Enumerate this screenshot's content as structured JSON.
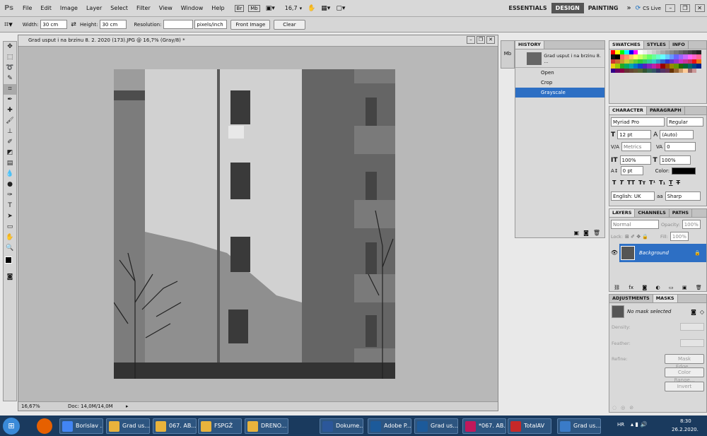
{
  "menubar": {
    "logo": "Ps",
    "items": [
      "File",
      "Edit",
      "Image",
      "Layer",
      "Select",
      "Filter",
      "View",
      "Window",
      "Help"
    ],
    "zoom": "16,7",
    "workspaces": [
      "ESSENTIALS",
      "DESIGN",
      "PAINTING"
    ],
    "cslive": "CS Live"
  },
  "options": {
    "width_label": "Width:",
    "width_value": "30 cm",
    "height_label": "Height:",
    "height_value": "30 cm",
    "resolution_label": "Resolution:",
    "resolution_value": "",
    "resolution_unit": "pixels/inch",
    "front_image": "Front Image",
    "clear": "Clear"
  },
  "document": {
    "title": "Grad usput i na brzinu 8. 2. 2020 (173).JPG @ 16,7% (Gray/8) *",
    "status_zoom": "16,67%",
    "status_doc": "Doc: 14,0M/14,0M"
  },
  "history": {
    "tab": "HISTORY",
    "snapshot": "Grad usput i na brzinu 8. ...",
    "steps": [
      "Open",
      "Crop",
      "Grayscale"
    ],
    "selected": 2
  },
  "swatches": {
    "tabs": [
      "SWATCHES",
      "STYLES",
      "INFO"
    ],
    "colors": [
      "#ff0000",
      "#ffff00",
      "#00ff00",
      "#00ffff",
      "#0000ff",
      "#ff00ff",
      "#ffffff",
      "#eeeeee",
      "#dddddd",
      "#cccccc",
      "#bbbbbb",
      "#aaaaaa",
      "#999999",
      "#888888",
      "#777777",
      "#666666",
      "#555555",
      "#444444",
      "#333333",
      "#222222",
      "#111111",
      "#000000",
      "#ff6666",
      "#ff9966",
      "#ffcc66",
      "#ffff66",
      "#ccff66",
      "#99ff66",
      "#66ff66",
      "#66ff99",
      "#66ffcc",
      "#66ffff",
      "#66ccff",
      "#6699ff",
      "#6666ff",
      "#9966ff",
      "#cc66ff",
      "#ff66ff",
      "#ff66cc",
      "#ff6699",
      "#cc3333",
      "#cc6633",
      "#cc9933",
      "#cccc33",
      "#99cc33",
      "#66cc33",
      "#33cc33",
      "#33cc66",
      "#33cc99",
      "#33cccc",
      "#3399cc",
      "#3366cc",
      "#3333cc",
      "#6633cc",
      "#9933cc",
      "#cc33cc",
      "#cc3399",
      "#cc3366",
      "#ee1111",
      "#ee7711",
      "#eecc11",
      "#99cc00",
      "#22aa22",
      "#00aa66",
      "#00aaaa",
      "#0077cc",
      "#1144cc",
      "#5522bb",
      "#8822bb",
      "#bb22aa",
      "#cc1177",
      "#990000",
      "#994400",
      "#998800",
      "#669900",
      "#226600",
      "#006633",
      "#006666",
      "#004488",
      "#002288",
      "#330088",
      "#660066",
      "#880044",
      "#663333",
      "#664433",
      "#665533",
      "#556633",
      "#335533",
      "#336655",
      "#335566",
      "#333366",
      "#553366",
      "#663355",
      "#663300",
      "#996633",
      "#cc9966",
      "#ffcc99",
      "#996666",
      "#cc9999"
    ]
  },
  "character": {
    "tabs": [
      "CHARACTER",
      "PARAGRAPH"
    ],
    "font": "Myriad Pro",
    "style": "Regular",
    "size": "12 pt",
    "leading": "(Auto)",
    "kerning": "Metrics",
    "tracking": "0",
    "vscale": "100%",
    "hscale": "100%",
    "baseline": "0 pt",
    "color_label": "Color:",
    "language": "English: UK",
    "aa": "Sharp"
  },
  "layers": {
    "tabs": [
      "LAYERS",
      "CHANNELS",
      "PATHS"
    ],
    "blend": "Normal",
    "opacity_label": "Opacity:",
    "opacity": "100%",
    "lock_label": "Lock:",
    "fill_label": "Fill:",
    "fill": "100%",
    "layer_name": "Background"
  },
  "masks": {
    "tabs": [
      "ADJUSTMENTS",
      "MASKS"
    ],
    "status": "No mask selected",
    "density": "Density:",
    "feather": "Feather:",
    "refine": "Refine:",
    "mask_edge": "Mask Edge...",
    "color_range": "Color Range...",
    "invert": "Invert"
  },
  "taskbar": {
    "items": [
      {
        "label": "Borislav ...",
        "icon": "chrome-icon",
        "color": "#4285f4"
      },
      {
        "label": "Grad us...",
        "icon": "folder-icon",
        "color": "#e8b33c"
      },
      {
        "label": "067. AB...",
        "icon": "folder-icon",
        "color": "#e8b33c"
      },
      {
        "label": "FSPGŽ",
        "icon": "folder-icon",
        "color": "#e8b33c"
      },
      {
        "label": "DRENO...",
        "icon": "folder-icon",
        "color": "#e8b33c"
      },
      {
        "label": "Dokume...",
        "icon": "word-icon",
        "color": "#2b579a"
      },
      {
        "label": "Adobe P...",
        "icon": "photoshop-icon",
        "color": "#1c5a9a"
      },
      {
        "label": "Grad us...",
        "icon": "photoshop-icon",
        "color": "#1c5a9a"
      },
      {
        "label": "*067. AB...",
        "icon": "indesign-icon",
        "color": "#c2185b"
      },
      {
        "label": "TotalAV",
        "icon": "shield-icon",
        "color": "#c62828"
      },
      {
        "label": "Grad us...",
        "icon": "image-viewer-icon",
        "color": "#3a7bc8"
      }
    ],
    "lang": "HR",
    "time": "8:30",
    "date": "26.2.2020."
  }
}
